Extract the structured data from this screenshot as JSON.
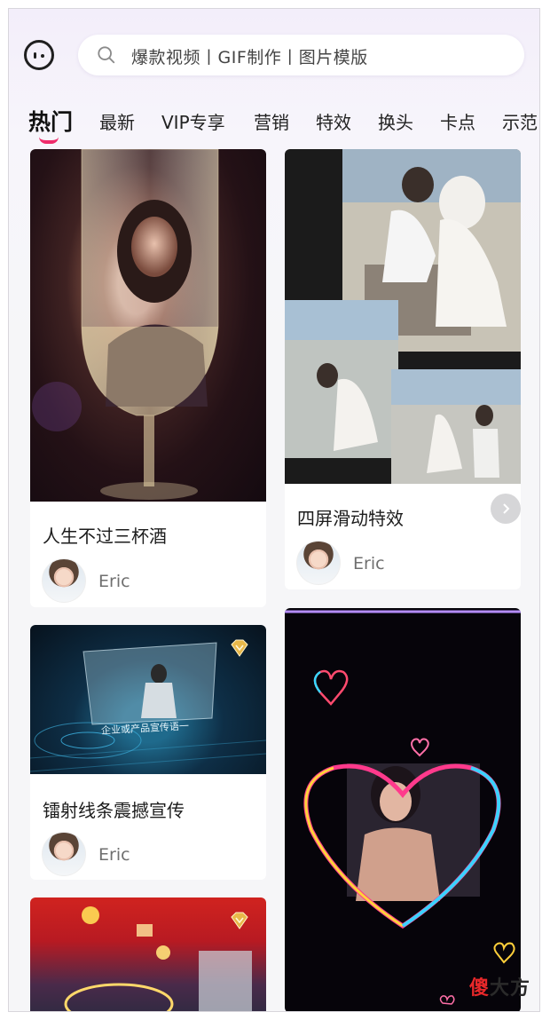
{
  "search": {
    "placeholder": "爆款视频丨GIF制作丨图片模版"
  },
  "tabs": [
    {
      "label": "热门",
      "active": true
    },
    {
      "label": "最新"
    },
    {
      "label": "VIP专享"
    },
    {
      "label": "营销"
    },
    {
      "label": "特效"
    },
    {
      "label": "换头"
    },
    {
      "label": "卡点"
    },
    {
      "label": "示范"
    }
  ],
  "cards": [
    {
      "title": "人生不过三杯酒",
      "author": "Eric",
      "vip": false
    },
    {
      "title": "四屏滑动特效",
      "author": "Eric",
      "vip": false
    },
    {
      "title": "镭射线条震撼宣传",
      "author": "Eric",
      "vip": true,
      "overlay_text": "企业或产品宣传语一"
    },
    {
      "title": "",
      "author": "",
      "vip": false
    },
    {
      "title": "",
      "author": "",
      "vip": true
    }
  ],
  "watermark": {
    "part1": "傻",
    "part2": "大方"
  },
  "colors": {
    "accent": "#ef2c6b",
    "vip_gold": "#e8b84a"
  },
  "icons": [
    "app-logo-icon",
    "search-icon",
    "chevron-right-icon",
    "vip-diamond-icon"
  ]
}
